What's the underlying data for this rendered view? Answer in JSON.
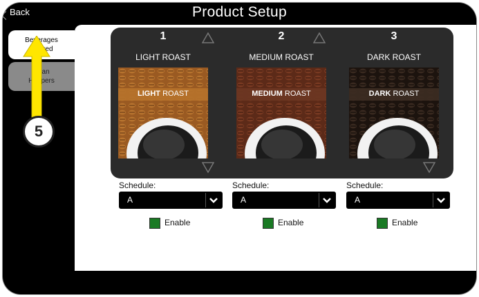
{
  "header": {
    "back_label": "Back",
    "title": "Product Setup"
  },
  "sidebar": {
    "tabs": [
      {
        "label": "Beverages Offered",
        "active": true
      },
      {
        "label": "Bean Hoppers",
        "active": false
      }
    ]
  },
  "beverages": [
    {
      "number": "1",
      "name": "LIGHT ROAST",
      "banner_bold": "LIGHT",
      "banner_rest": " ROAST",
      "schedule_label": "Schedule:",
      "schedule": "A",
      "enable_label": "Enable",
      "enabled": true
    },
    {
      "number": "2",
      "name": "MEDIUM ROAST",
      "banner_bold": "MEDIUM",
      "banner_rest": " ROAST",
      "schedule_label": "Schedule:",
      "schedule": "A",
      "enable_label": "Enable",
      "enabled": true
    },
    {
      "number": "3",
      "name": "DARK ROAST",
      "banner_bold": "DARK",
      "banner_rest": " ROAST",
      "schedule_label": "Schedule:",
      "schedule": "A",
      "enable_label": "Enable",
      "enabled": true
    }
  ],
  "annotation": {
    "step": "5"
  },
  "colors": {
    "accent_yellow": "#ffe600",
    "enable_green": "#1a7a24",
    "panel_dark": "#2b2b2b"
  }
}
